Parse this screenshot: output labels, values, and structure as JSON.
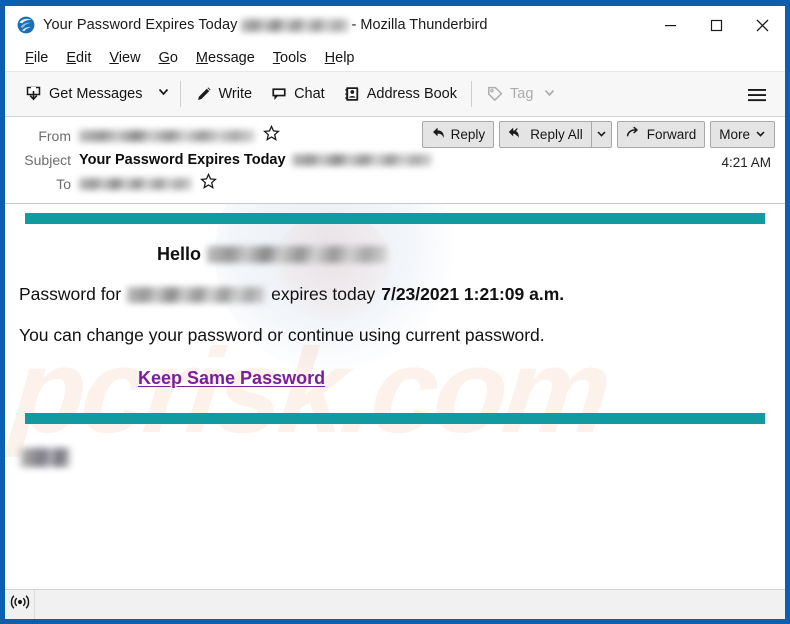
{
  "window": {
    "title_prefix": "Your Password Expires Today",
    "title_suffix": "- Mozilla Thunderbird",
    "app_icon": "thunderbird-icon",
    "controls": {
      "minimize": "minimize-icon",
      "maximize": "maximize-icon",
      "close": "close-icon"
    },
    "frame_color": "#0b5fb0"
  },
  "menubar": {
    "items": [
      {
        "label": "File",
        "accel": "F"
      },
      {
        "label": "Edit",
        "accel": "E"
      },
      {
        "label": "View",
        "accel": "V"
      },
      {
        "label": "Go",
        "accel": "G"
      },
      {
        "label": "Message",
        "accel": "M"
      },
      {
        "label": "Tools",
        "accel": "T"
      },
      {
        "label": "Help",
        "accel": "H"
      }
    ]
  },
  "toolbar": {
    "get_messages_label": "Get Messages",
    "get_messages_icon": "inbox-download-icon",
    "get_messages_dropdown_icon": "chevron-down-icon",
    "write_label": "Write",
    "write_icon": "pencil-icon",
    "chat_label": "Chat",
    "chat_icon": "chat-bubble-icon",
    "address_book_label": "Address Book",
    "address_book_icon": "address-book-icon",
    "tag_label": "Tag",
    "tag_icon": "tag-icon",
    "tag_dropdown_icon": "chevron-down-icon",
    "tag_disabled": true,
    "app_menu_icon": "hamburger-menu-icon"
  },
  "message_header": {
    "from_label": "From",
    "from_value_redacted": true,
    "from_star_icon": "star-outline-icon",
    "subject_label": "Subject",
    "subject_value": "Your Password Expires Today",
    "subject_value_redacted": true,
    "to_label": "To",
    "to_value_redacted": true,
    "to_star_icon": "star-outline-icon",
    "timestamp": "4:21 AM",
    "actions": {
      "reply_label": "Reply",
      "reply_icon": "reply-arrow-icon",
      "reply_all_label": "Reply All",
      "reply_all_icon": "reply-all-arrow-icon",
      "reply_all_dropdown_icon": "chevron-down-icon",
      "forward_label": "Forward",
      "forward_icon": "forward-arrow-icon",
      "more_label": "More",
      "more_dropdown_icon": "chevron-down-icon"
    }
  },
  "email_body": {
    "accent_color": "#119ba1",
    "top_rule": "teal-horizontal-rule",
    "bottom_rule": "teal-horizontal-rule",
    "greeting": "Hello",
    "greeting_recipient_redacted": true,
    "password_line_prefix": "Password for",
    "password_account_redacted": true,
    "password_line_middle": "expires today",
    "expiry_datetime": "7/23/2021 1:21:09 a.m.",
    "instruction": "You can change your password or continue using current password.",
    "cta_label": "Keep Same Password",
    "cta_color": "#7a1f9c",
    "footer_redacted": true,
    "watermark": "pcrisk.com"
  },
  "statusbar": {
    "connection_icon": "broadcast-online-icon",
    "text": ""
  }
}
